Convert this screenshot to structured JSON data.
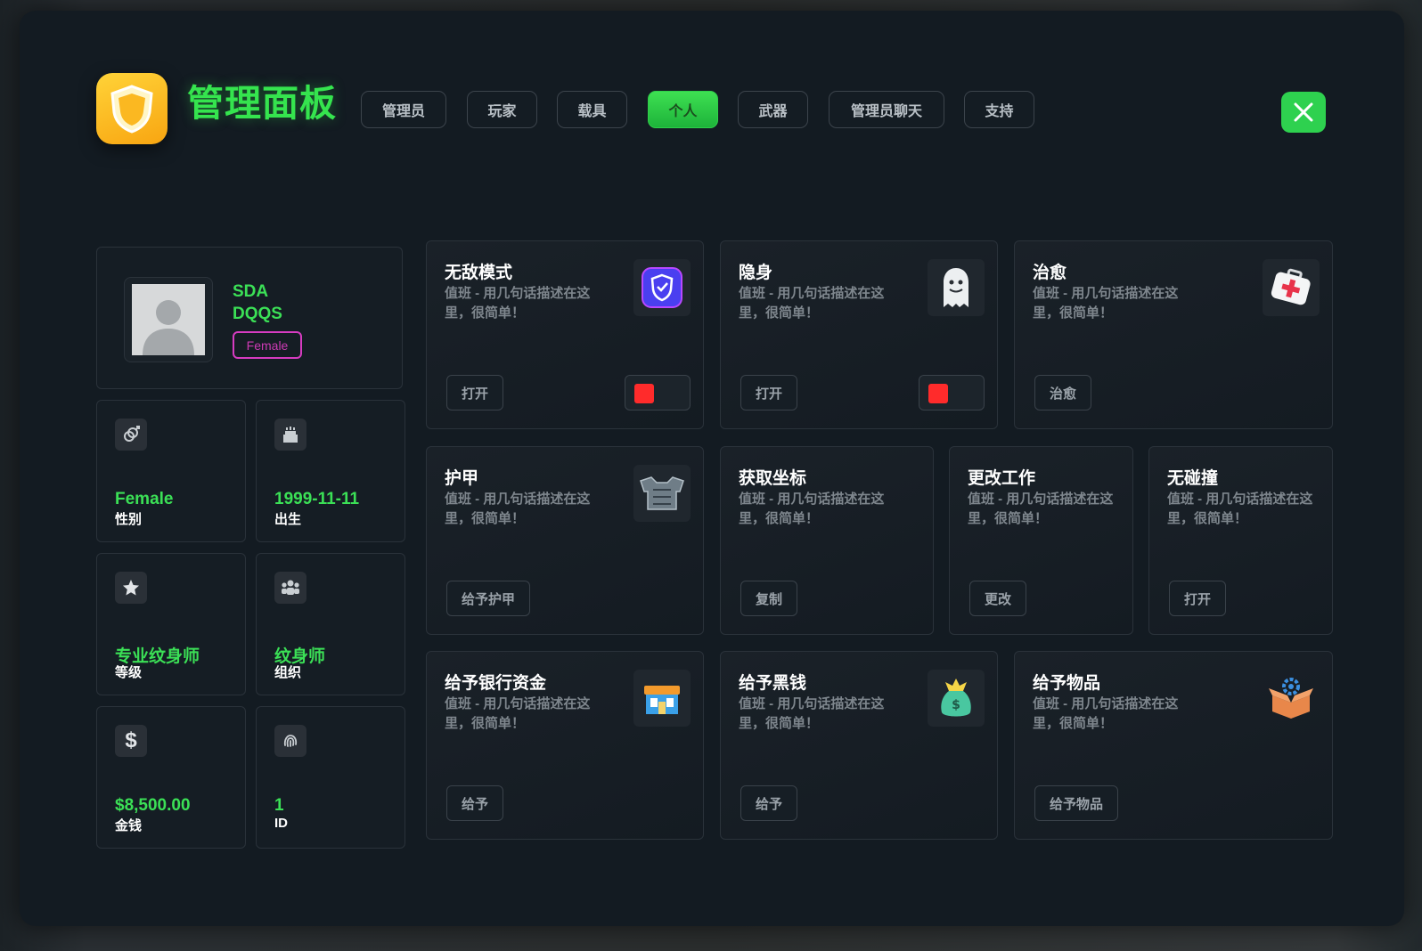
{
  "header": {
    "title": "管理面板",
    "tabs": [
      {
        "label": "管理员",
        "active": false
      },
      {
        "label": "玩家",
        "active": false
      },
      {
        "label": "载具",
        "active": false
      },
      {
        "label": "个人",
        "active": true
      },
      {
        "label": "武器",
        "active": false
      },
      {
        "label": "管理员聊天",
        "active": false
      },
      {
        "label": "支持",
        "active": false
      }
    ],
    "close_icon": "close-icon"
  },
  "profile": {
    "first_name": "SDA",
    "last_name": "DQQS",
    "gender_badge": "Female"
  },
  "stats": [
    {
      "icon": "gender-icon",
      "value": "Female",
      "label": "性别"
    },
    {
      "icon": "cake-icon",
      "value": "1999-11-11",
      "label": "出生"
    },
    {
      "icon": "star-icon",
      "value": "专业纹身师",
      "label": "等级"
    },
    {
      "icon": "group-icon",
      "value": "纹身师",
      "label": "组织"
    },
    {
      "icon": "dollar-icon",
      "value": "$8,500.00",
      "label": "金钱"
    },
    {
      "icon": "fingerprint-icon",
      "value": "1",
      "label": "ID"
    }
  ],
  "cards": [
    {
      "title": "无敌模式",
      "desc": "值班 - 用几句话描述在这里，很简单！",
      "button": "打开",
      "icon": "shield-icon",
      "toggle": "off"
    },
    {
      "title": "隐身",
      "desc": "值班 - 用几句话描述在这里，很简单！",
      "button": "打开",
      "icon": "ghost-icon",
      "toggle": "off"
    },
    {
      "title": "治愈",
      "desc": "值班 - 用几句话描述在这里，很简单！",
      "button": "治愈",
      "icon": "medkit-icon"
    },
    {
      "title": "护甲",
      "desc": "值班 - 用几句话描述在这里，很简单！",
      "button": "给予护甲",
      "icon": "armor-icon"
    },
    {
      "title": "获取坐标",
      "desc": "值班 - 用几句话描述在这里，很简单！",
      "button": "复制"
    },
    {
      "title": "更改工作",
      "desc": "值班 - 用几句话描述在这里，很简单！",
      "button": "更改"
    },
    {
      "title": "无碰撞",
      "desc": "值班 - 用几句话描述在这里，很简单！",
      "button": "打开"
    },
    {
      "title": "给予银行资金",
      "desc": "值班 - 用几句话描述在这里，很简单！",
      "button": "给予",
      "icon": "bank-icon"
    },
    {
      "title": "给予黑钱",
      "desc": "值班 - 用几句话描述在这里，很简单！",
      "button": "给予",
      "icon": "money-bag-icon"
    },
    {
      "title": "给予物品",
      "desc": "值班 - 用几句话描述在这里，很简单！",
      "button": "给予物品",
      "icon": "item-box-icon"
    }
  ],
  "colors": {
    "accent": "#35e44e",
    "badge": "#d63cc1",
    "toggle_off": "#ff2b2b",
    "panel": "#131b22"
  }
}
